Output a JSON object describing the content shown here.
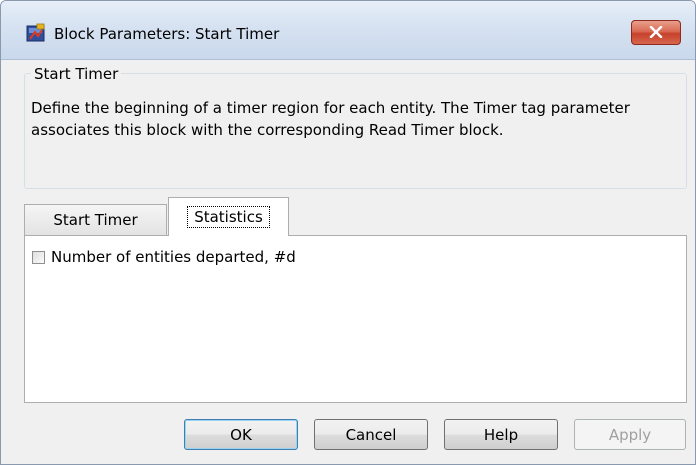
{
  "window": {
    "title": "Block Parameters: Start Timer",
    "app_icon": "simulink-block-icon",
    "close_icon": "close-icon"
  },
  "group": {
    "legend": "Start Timer",
    "description": "Define the beginning of a timer region for each entity. The Timer tag parameter associates this block with the corresponding Read Timer block."
  },
  "tabs": [
    {
      "label": "Start Timer",
      "active": false
    },
    {
      "label": "Statistics",
      "active": true
    }
  ],
  "statistics": {
    "departed_checkbox_label": "Number of entities departed, #d",
    "departed_checked": false
  },
  "buttons": {
    "ok": "OK",
    "cancel": "Cancel",
    "help": "Help",
    "apply": "Apply"
  },
  "colors": {
    "close_button": "#c7422b",
    "title_bar": "#d6e2f1",
    "dialog_background": "#f0f0f0"
  }
}
